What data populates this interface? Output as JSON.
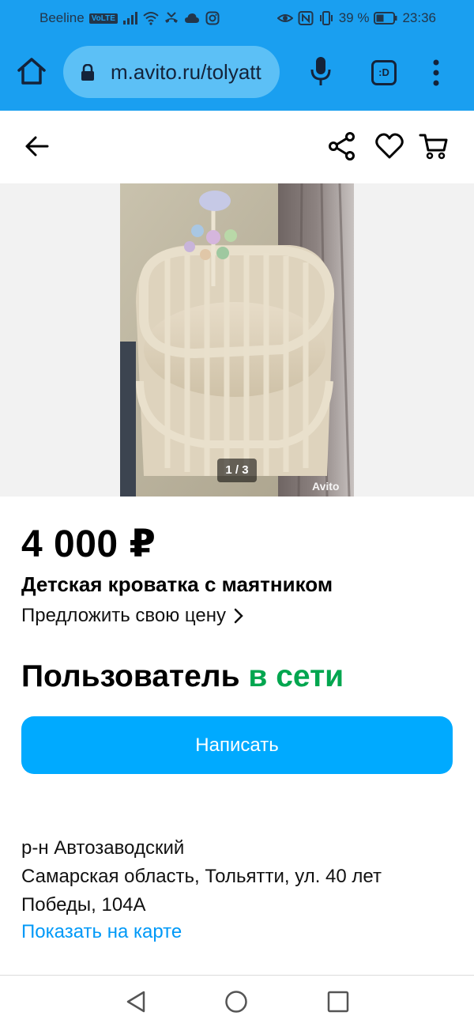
{
  "status_bar": {
    "carrier": "Beeline",
    "volte": "VoLTE",
    "battery": "39 %",
    "time": "23:36",
    "icons_left": [
      "signal-icon",
      "wifi-icon",
      "missed-call-icon",
      "cloud-icon",
      "instagram-icon"
    ],
    "icons_right": [
      "eye-icon",
      "nfc-icon",
      "vibrate-icon",
      "battery-icon"
    ]
  },
  "browser": {
    "url": "m.avito.ru/tolyatt",
    "tabs_label": ":D"
  },
  "gallery": {
    "counter": "1 / 3",
    "watermark": "Avito"
  },
  "listing": {
    "price": "4 000 ₽",
    "title": "Детская кроватка с маятником",
    "offer_label": "Предложить свою цену"
  },
  "seller": {
    "label": "Пользователь",
    "status": "в сети"
  },
  "actions": {
    "write_label": "Написать"
  },
  "location": {
    "district": "р-н Автозаводский",
    "address": "Самарская область, Тольятти, ул. 40 лет Победы, 104А",
    "map_link": "Показать на карте"
  },
  "colors": {
    "browser_bar": "#1a9ff0",
    "accent_button": "#00aaff",
    "online_status": "#02a64f",
    "link": "#0099f7"
  }
}
